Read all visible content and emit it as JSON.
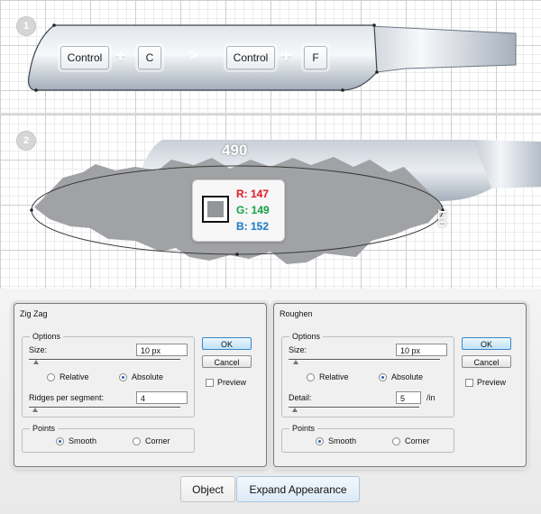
{
  "step1": {
    "badge": "1",
    "keys": [
      "Control",
      "C",
      "Control",
      "F"
    ],
    "plus": "+",
    "arrow": ">"
  },
  "step2": {
    "badge": "2",
    "width_label": "490",
    "height_label": "110",
    "rgb": {
      "r": "R: 147",
      "g": "G: 149",
      "b": "B: 152",
      "swatch_color": "#939598"
    }
  },
  "zigzag": {
    "title": "Zig Zag",
    "options_title": "Options",
    "size_label": "Size:",
    "size_value": "10 px",
    "size_slider": 0.05,
    "relative_label": "Relative",
    "absolute_label": "Absolute",
    "mode": "Absolute",
    "ridges_label": "Ridges per segment:",
    "ridges_value": "4",
    "ridges_slider": 0.04,
    "points_title": "Points",
    "smooth_label": "Smooth",
    "corner_label": "Corner",
    "points": "Smooth",
    "ok_label": "OK",
    "cancel_label": "Cancel",
    "preview_label": "Preview",
    "preview_checked": false
  },
  "roughen": {
    "title": "Roughen",
    "options_title": "Options",
    "size_label": "Size:",
    "size_value": "10 px",
    "size_slider": 0.05,
    "relative_label": "Relative",
    "absolute_label": "Absolute",
    "mode": "Absolute",
    "detail_label": "Detail:",
    "detail_value": "5",
    "detail_unit": "/in",
    "detail_slider": 0.05,
    "points_title": "Points",
    "smooth_label": "Smooth",
    "corner_label": "Corner",
    "points": "Smooth",
    "ok_label": "OK",
    "cancel_label": "Cancel",
    "preview_label": "Preview",
    "preview_checked": false
  },
  "menu": {
    "object_label": "Object",
    "expand_label": "Expand Appearance"
  },
  "colors": {
    "blade_light": "#f4f6f9",
    "blade_dark": "#aeb7c3",
    "rough_shape": "#a1a2a5",
    "r_color": "#e8202e",
    "g_color": "#19a94b",
    "b_color": "#1f7fd0"
  }
}
